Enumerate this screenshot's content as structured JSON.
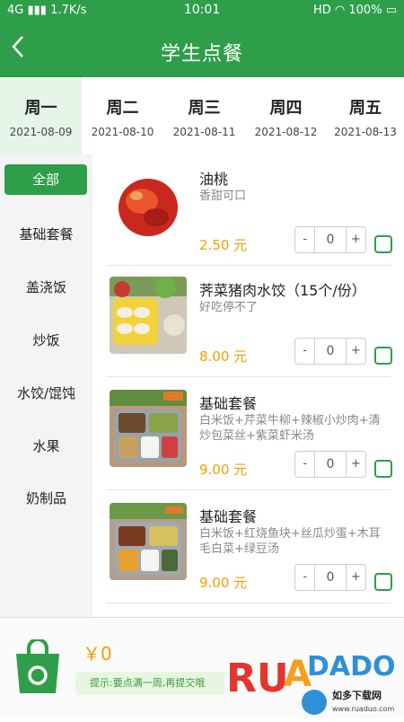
{
  "status": {
    "network": "4G",
    "speed": "1.7K/s",
    "time": "10:01",
    "indicators": "HD",
    "battery": "100%"
  },
  "header": {
    "title": "学生点餐",
    "back_icon": "chevron-left-icon"
  },
  "days": [
    {
      "name": "周一",
      "date": "2021-08-09",
      "active": true
    },
    {
      "name": "周二",
      "date": "2021-08-10"
    },
    {
      "name": "周三",
      "date": "2021-08-11"
    },
    {
      "name": "周四",
      "date": "2021-08-12"
    },
    {
      "name": "周五",
      "date": "2021-08-13"
    }
  ],
  "categories": [
    "全部",
    "基础套餐",
    "盖浇饭",
    "炒饭",
    "水饺/馄饨",
    "水果",
    "奶制品"
  ],
  "items": [
    {
      "name": "油桃",
      "desc": "香甜可口",
      "price": "2.50 元",
      "qty": "0",
      "minus": "-",
      "plus": "+"
    },
    {
      "name": "荠菜猪肉水饺（15个/份）",
      "desc": "好吃停不了",
      "price": "8.00 元",
      "qty": "0",
      "minus": "-",
      "plus": "+"
    },
    {
      "name": "基础套餐",
      "desc": "白米饭+芹菜牛柳+辣椒小炒肉+清炒包菜丝+紫菜虾米汤",
      "price": "9.00 元",
      "qty": "0",
      "minus": "-",
      "plus": "+"
    },
    {
      "name": "基础套餐",
      "desc": "白米饭+红烧鱼块+丝瓜炒蛋+木耳毛白菜+绿豆汤",
      "price": "9.00 元",
      "qty": "0",
      "minus": "-",
      "plus": "+"
    }
  ],
  "cart": {
    "total": "￥0",
    "tip": "提示:要点满一周,再提交哦",
    "icon": "shopping-bag-icon"
  },
  "watermark": {
    "brand": "RUANDADO",
    "cn": "如多下载网",
    "url": "www.ruaduo.com"
  },
  "colors": {
    "primary": "#2e9e4a",
    "price": "#f0a000",
    "active_day_bg": "#e6f5e8"
  }
}
